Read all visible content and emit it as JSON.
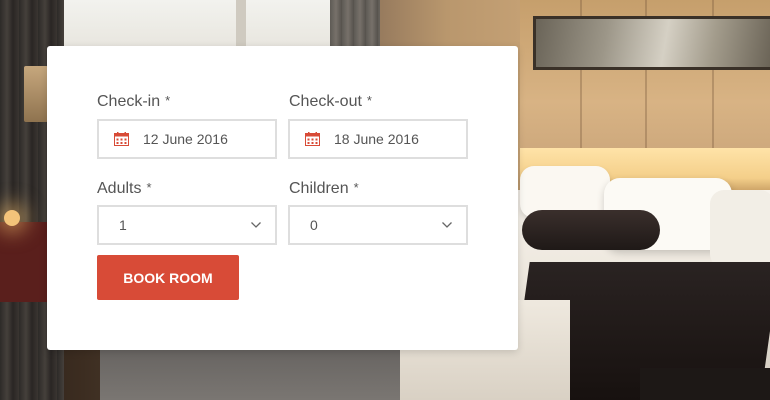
{
  "form": {
    "checkin": {
      "label": "Check-in",
      "required_mark": "*",
      "value": "12 June 2016",
      "icon": "calendar-icon"
    },
    "checkout": {
      "label": "Check-out",
      "required_mark": "*",
      "value": "18 June 2016",
      "icon": "calendar-icon"
    },
    "adults": {
      "label": "Adults",
      "required_mark": "*",
      "value": "1",
      "icon": "chevron-down-icon"
    },
    "children": {
      "label": "Children",
      "required_mark": "*",
      "value": "0",
      "icon": "chevron-down-icon"
    },
    "submit_label": "BOOK ROOM"
  },
  "colors": {
    "accent": "#d84b37",
    "label_text": "#555555",
    "field_border": "#dedede",
    "card_background": "#ffffff"
  }
}
